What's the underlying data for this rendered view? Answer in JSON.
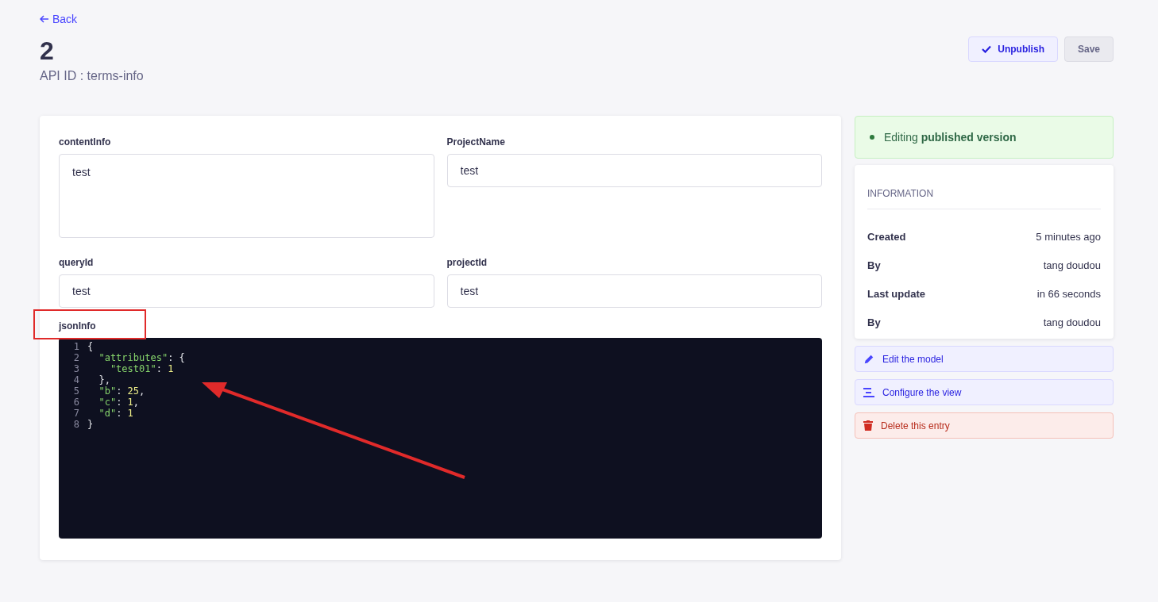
{
  "header": {
    "back": "Back",
    "title": "2",
    "subtitle": "API ID : terms-info"
  },
  "actions": [
    {
      "kind": "primary",
      "label": "Unpublish",
      "disabled": false
    },
    {
      "kind": "plain",
      "label": "Save",
      "disabled": true
    }
  ],
  "fields": [
    {
      "kind": "textarea",
      "label": "contentInfo",
      "value": "test"
    },
    {
      "kind": "input",
      "label": "ProjectName",
      "value": "test"
    },
    {
      "kind": "input",
      "label": "queryId",
      "value": "test"
    },
    {
      "kind": "input",
      "label": "projectId",
      "value": "test"
    }
  ],
  "json_field": {
    "label": "jsonInfo",
    "lines": [
      {
        "number": "1",
        "tokens": [
          {
            "kind": "punct",
            "text": "{"
          }
        ]
      },
      {
        "number": "2",
        "tokens": [
          {
            "kind": "key",
            "text": "  \"attributes\""
          },
          {
            "kind": "punct",
            "text": ": {"
          }
        ]
      },
      {
        "number": "3",
        "tokens": [
          {
            "kind": "key",
            "text": "    \"test01\""
          },
          {
            "kind": "punct",
            "text": ": "
          },
          {
            "kind": "number",
            "text": "1"
          }
        ]
      },
      {
        "number": "4",
        "tokens": [
          {
            "kind": "punct",
            "text": "  },"
          }
        ]
      },
      {
        "number": "5",
        "tokens": [
          {
            "kind": "key",
            "text": "  \"b\""
          },
          {
            "kind": "punct",
            "text": ": "
          },
          {
            "kind": "number",
            "text": "25"
          },
          {
            "kind": "punct",
            "text": ","
          }
        ]
      },
      {
        "number": "6",
        "tokens": [
          {
            "kind": "key",
            "text": "  \"c\""
          },
          {
            "kind": "punct",
            "text": ": "
          },
          {
            "kind": "number",
            "text": "1"
          },
          {
            "kind": "punct",
            "text": ","
          }
        ]
      },
      {
        "number": "7",
        "tokens": [
          {
            "kind": "key",
            "text": "  \"d\""
          },
          {
            "kind": "punct",
            "text": ": "
          },
          {
            "kind": "number",
            "text": "1"
          }
        ]
      },
      {
        "number": "8",
        "tokens": [
          {
            "kind": "punct",
            "text": "}"
          }
        ]
      }
    ]
  },
  "status": {
    "text": "Editing **published version**",
    "color": "#2f7a3e"
  },
  "information": {
    "title": "INFORMATION",
    "rows": [
      {
        "label": "Created",
        "value": "5 minutes ago"
      },
      {
        "label": "By",
        "value": "tang doudou"
      },
      {
        "label": "Last update",
        "value": "in 66 seconds"
      },
      {
        "label": "By",
        "value": "tang doudou"
      }
    ]
  },
  "links": [
    {
      "kind": "edit",
      "label": "Edit the model"
    },
    {
      "kind": "configure",
      "label": "Configure the view"
    },
    {
      "kind": "delete",
      "label": "Delete this entry"
    }
  ]
}
